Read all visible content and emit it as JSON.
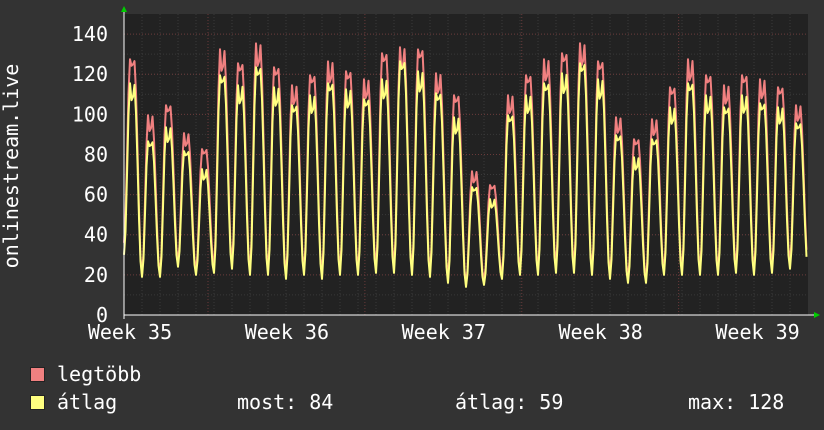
{
  "chart_data": {
    "type": "line",
    "ylabel": "onlinestream.live",
    "ylim": [
      0,
      150
    ],
    "yticks": [
      0,
      20,
      40,
      60,
      80,
      100,
      120,
      140
    ],
    "x_tick_labels": [
      "Week 35",
      "Week 36",
      "Week 37",
      "Week 38",
      "Week 39"
    ],
    "grid": true,
    "legend_placement": "bottom-left",
    "series": [
      {
        "name": "legtöbb",
        "color": "#f08080",
        "daily_peaks": [
          128,
          100,
          105,
          91,
          83,
          133,
          126,
          136,
          124,
          115,
          120,
          127,
          122,
          118,
          131,
          134,
          133,
          121,
          110,
          72,
          65,
          110,
          120,
          128,
          131,
          136,
          127,
          99,
          88,
          98,
          114,
          128,
          120,
          115,
          120,
          118,
          114,
          105
        ],
        "daily_troughs": [
          36,
          20,
          20,
          26,
          22,
          24,
          26,
          22,
          22,
          20,
          22,
          20,
          22,
          22,
          24,
          24,
          22,
          21,
          18,
          15,
          17,
          20,
          22,
          22,
          24,
          24,
          22,
          20,
          18,
          18,
          22,
          22,
          22,
          22,
          24,
          22,
          24,
          26
        ]
      },
      {
        "name": "átlag",
        "color": "#ffff80",
        "daily_peaks": [
          116,
          87,
          94,
          82,
          73,
          120,
          115,
          124,
          114,
          105,
          110,
          116,
          113,
          108,
          118,
          127,
          122,
          111,
          99,
          64,
          58,
          100,
          110,
          116,
          121,
          126,
          118,
          90,
          79,
          88,
          104,
          116,
          110,
          104,
          110,
          106,
          104,
          96
        ],
        "daily_troughs": [
          30,
          19,
          19,
          24,
          20,
          21,
          23,
          20,
          20,
          18,
          20,
          18,
          20,
          20,
          21,
          21,
          20,
          19,
          16,
          14,
          15,
          18,
          20,
          20,
          21,
          21,
          20,
          18,
          16,
          16,
          20,
          20,
          20,
          20,
          21,
          20,
          21,
          23
        ]
      }
    ]
  },
  "legend": {
    "max_label": "legtöbb",
    "avg_label": "átlag"
  },
  "stats": {
    "now": "most: 84",
    "avg": "átlag: 59",
    "max": "max: 128"
  },
  "colors": {
    "background": "#333333",
    "plot_background": "#222222",
    "grid": "#444444",
    "max_line": "#f08080",
    "avg_line": "#ffff80",
    "axis": "#ffffff",
    "arrow": "#00cc00"
  }
}
